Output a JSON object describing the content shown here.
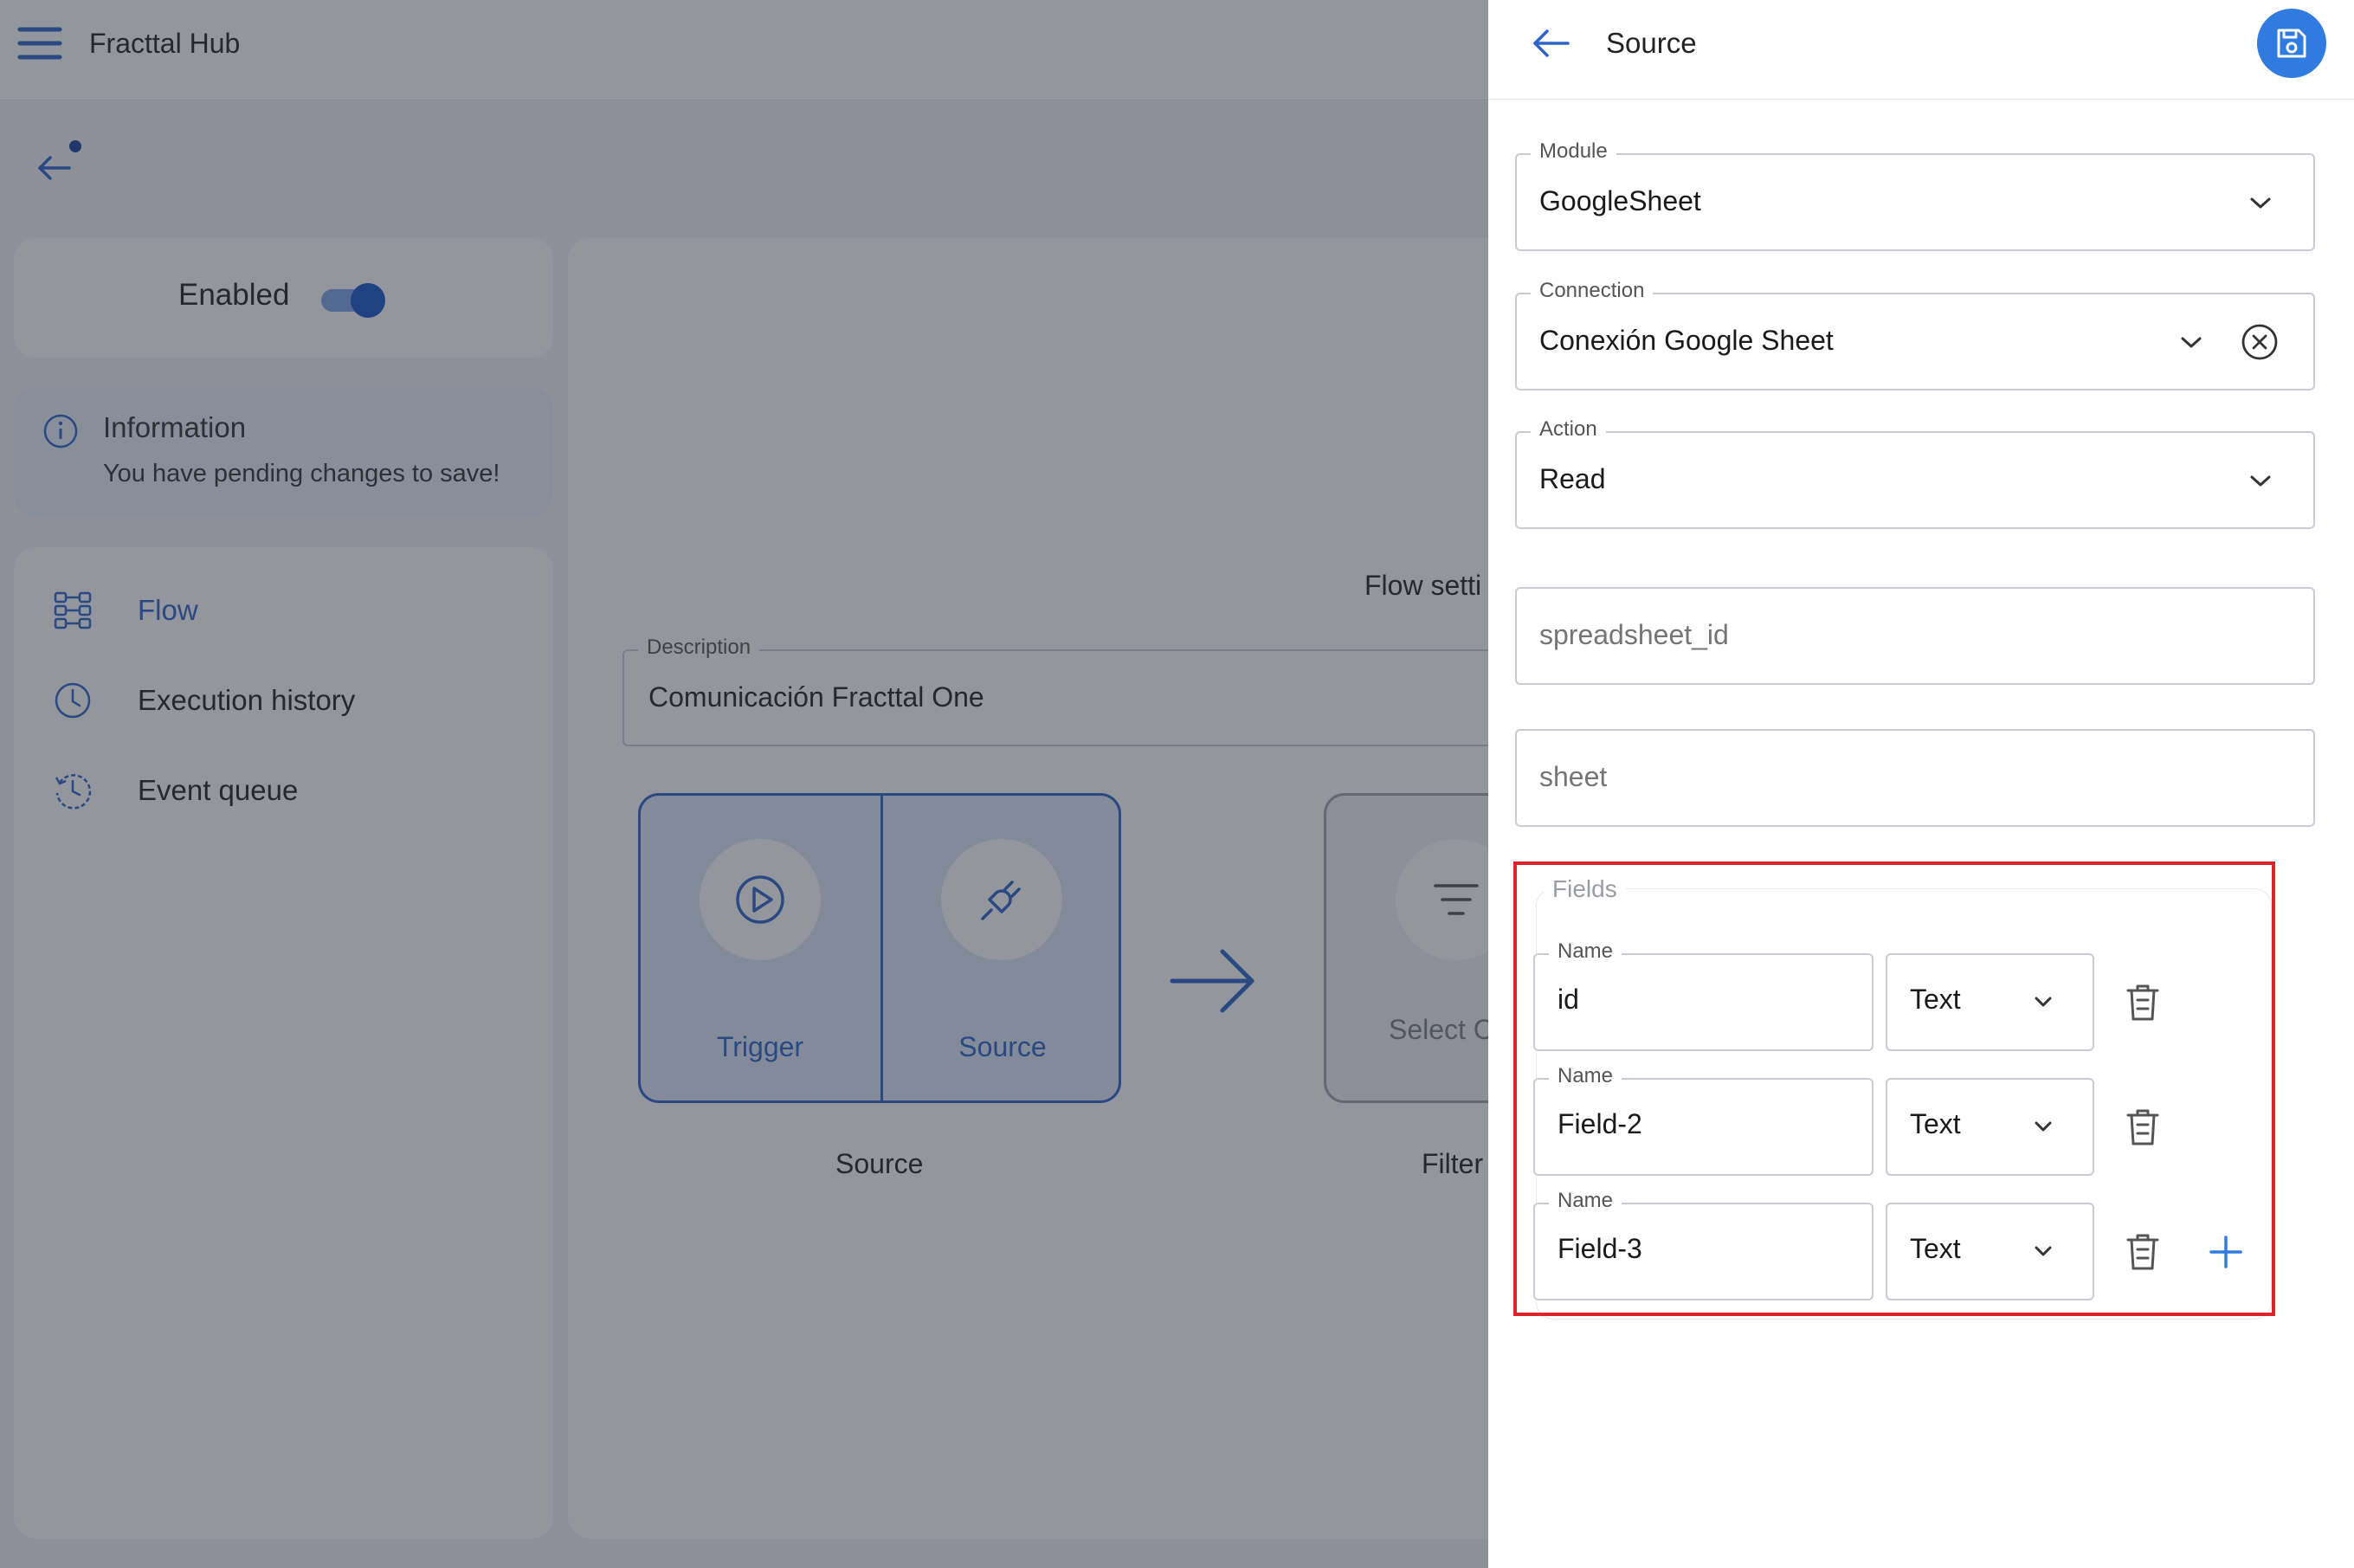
{
  "app": {
    "title": "Fracttal Hub",
    "enabled_label": "Enabled",
    "enabled": true,
    "info": {
      "title": "Information",
      "text": "You have pending changes to save!"
    },
    "nav": [
      {
        "label": "Flow",
        "icon": "flow-icon",
        "active": true
      },
      {
        "label": "Execution history",
        "icon": "clock-icon",
        "active": false
      },
      {
        "label": "Event queue",
        "icon": "history-icon",
        "active": false
      }
    ],
    "main": {
      "flow_settings": "Flow setti",
      "description_label": "Description",
      "description_value": "Comunicación Fracttal One",
      "steps": {
        "trigger_label": "Trigger",
        "source_label": "Source",
        "source_caption": "Source",
        "filter_label": "Select O",
        "filter_caption": "Filter"
      }
    }
  },
  "drawer": {
    "title": "Source",
    "save_icon": "save-icon",
    "module": {
      "label": "Module",
      "value": "GoogleSheet"
    },
    "connection": {
      "label": "Connection",
      "value": "Conexión Google Sheet"
    },
    "action": {
      "label": "Action",
      "value": "Read"
    },
    "spreadsheet_id": {
      "placeholder": "spreadsheet_id"
    },
    "sheet": {
      "placeholder": "sheet"
    },
    "fields": {
      "label": "Fields",
      "rows": [
        {
          "name_label": "Name",
          "name": "id",
          "type": "Text"
        },
        {
          "name_label": "Name",
          "name": "Field-2",
          "type": "Text"
        },
        {
          "name_label": "Name",
          "name": "Field-3",
          "type": "Text"
        }
      ]
    }
  },
  "colors": {
    "accent": "#2d63c8",
    "save_button": "#2f7be0",
    "highlight": "#e0232b",
    "overlay": "rgba(40,46,60,0.5)"
  }
}
